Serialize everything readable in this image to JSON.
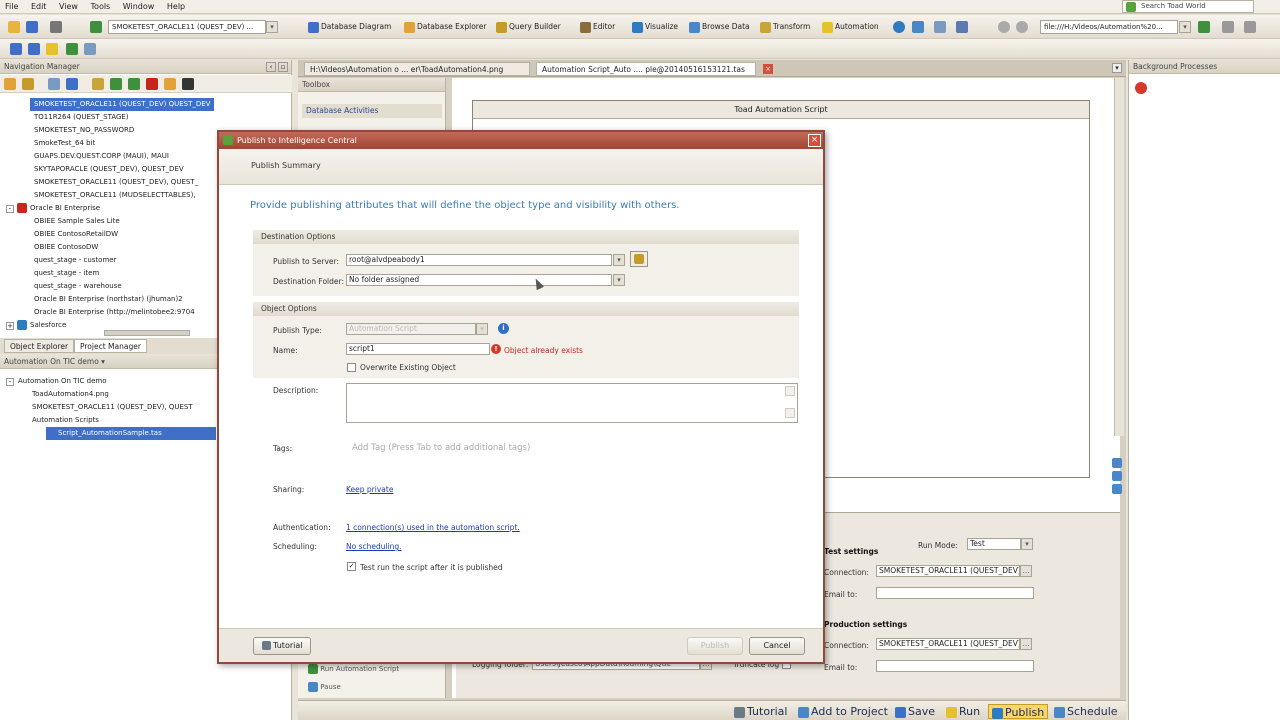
{
  "menu": [
    "File",
    "Edit",
    "View",
    "Tools",
    "Window",
    "Help"
  ],
  "search": {
    "placeholder": "Search Toad World"
  },
  "toolbar": {
    "connection_combo": "SMOKETEST_ORACLE11 (QUEST_DEV) ...",
    "items": [
      "Database Diagram",
      "Database Explorer",
      "Query Builder",
      "Editor",
      "Visualize",
      "Browse Data",
      "Transform",
      "Automation"
    ],
    "path_combo": "file:///H:/Videos/Automation%20..."
  },
  "nav": {
    "title": "Navigation Manager",
    "tree": [
      {
        "label": "SMOKETEST_ORACLE11 (QUEST_DEV) QUEST_DEV",
        "selected": true
      },
      {
        "label": "TO11R264 (QUEST_STAGE)"
      },
      {
        "label": "SMOKETEST_NO_PASSWORD"
      },
      {
        "label": "SmokeTest_64 bit"
      },
      {
        "label": "GUAPS.DEV.QUEST.CORP (MAUI), MAUI"
      },
      {
        "label": "SKYTAPORACLE (QUEST_DEV), QUEST_DEV"
      },
      {
        "label": "SMOKETEST_ORACLE11 (QUEST_DEV), QUEST_"
      },
      {
        "label": "SMOKETEST_ORACLE11 (MUDSELECTTABLES),"
      },
      {
        "label": "Oracle BI Enterprise",
        "group": true
      },
      {
        "label": "OBIEE Sample Sales Lite"
      },
      {
        "label": "OBIEE ContosoRetailDW"
      },
      {
        "label": "OBIEE ContosoDW"
      },
      {
        "label": "quest_stage - customer"
      },
      {
        "label": "quest_stage - item"
      },
      {
        "label": "quest_stage - warehouse"
      },
      {
        "label": "Oracle BI Enterprise (northstar) (jhuman)2"
      },
      {
        "label": "Oracle BI Enterprise (http://melintobee2:9704"
      },
      {
        "label": "Salesforce",
        "group": true
      }
    ],
    "tabs": [
      "Object Explorer",
      "Project Manager"
    ]
  },
  "project": {
    "combo": "Automation On TIC demo",
    "tree": [
      {
        "label": "Automation On TIC demo",
        "group": true
      },
      {
        "label": "ToadAutomation4.png"
      },
      {
        "label": "SMOKETEST_ORACLE11 (QUEST_DEV), QUEST"
      },
      {
        "label": "Automation Scripts",
        "group": true
      },
      {
        "label": "Script_AutomationSample.tas",
        "selected": true
      }
    ]
  },
  "center": {
    "tabs": [
      "H:\\Videos\\Automation o ...  er\\ToadAutomation4.png",
      "Automation Script_Auto  ....  ple@20140516153121.tas"
    ],
    "toolbox_title": "Toolbox",
    "toolbox_section": "Database Activities",
    "toolbox_bottom": [
      "Run Automation Script",
      "Pause"
    ],
    "script_title": "Toad Automation Script",
    "logging_label": "Logging folder:",
    "logging_value": "Users\\Jeasco\\AppData\\Roaming\\Que",
    "truncate_label": "Truncate log",
    "run_mode_label": "Run Mode:",
    "run_mode_value": "Test",
    "test_settings_label": "Test settings",
    "prod_settings_label": "Production settings",
    "connection_label": "Connection:",
    "email_label": "Email to:",
    "connection_value": "SMOKETEST_ORACLE11 (QUEST_DEV)"
  },
  "right": {
    "title": "Background Processes"
  },
  "statusbar": [
    "Tutorial",
    "Add to Project",
    "Save",
    "Run",
    "Publish",
    "Schedule"
  ],
  "dialog": {
    "title": "Publish to Intelligence Central",
    "header": "Publish Summary",
    "intro": "Provide publishing attributes that will define the object type and visibility with others.",
    "destination": {
      "group": "Destination Options",
      "server_label": "Publish to Server:",
      "server_value": "root@alvdpeabody1",
      "folder_label": "Destination Folder:",
      "folder_value": "No folder assigned"
    },
    "object": {
      "group": "Object Options",
      "type_label": "Publish Type:",
      "type_value": "Automation Script",
      "name_label": "Name:",
      "name_value": "script1",
      "error": "Object already exists",
      "overwrite_label": "Overwrite Existing Object"
    },
    "description_label": "Description:",
    "tags_label": "Tags:",
    "tags_placeholder": "Add Tag (Press Tab to add additional tags)",
    "sharing_label": "Sharing:",
    "sharing_value": "Keep private",
    "auth_label": "Authentication:",
    "auth_value": "1 connection(s) used in the automation script.",
    "sched_label": "Scheduling:",
    "sched_value": "No scheduling.",
    "testrun_label": "Test run the script after it is published",
    "buttons": {
      "tutorial": "Tutorial",
      "publish": "Publish",
      "cancel": "Cancel"
    }
  },
  "colors": {
    "selection": "#3f6fc8",
    "dialog_title": "#a04434",
    "link": "#1a3cb8",
    "intro_text": "#3b7bbf",
    "error": "#c8261b"
  }
}
